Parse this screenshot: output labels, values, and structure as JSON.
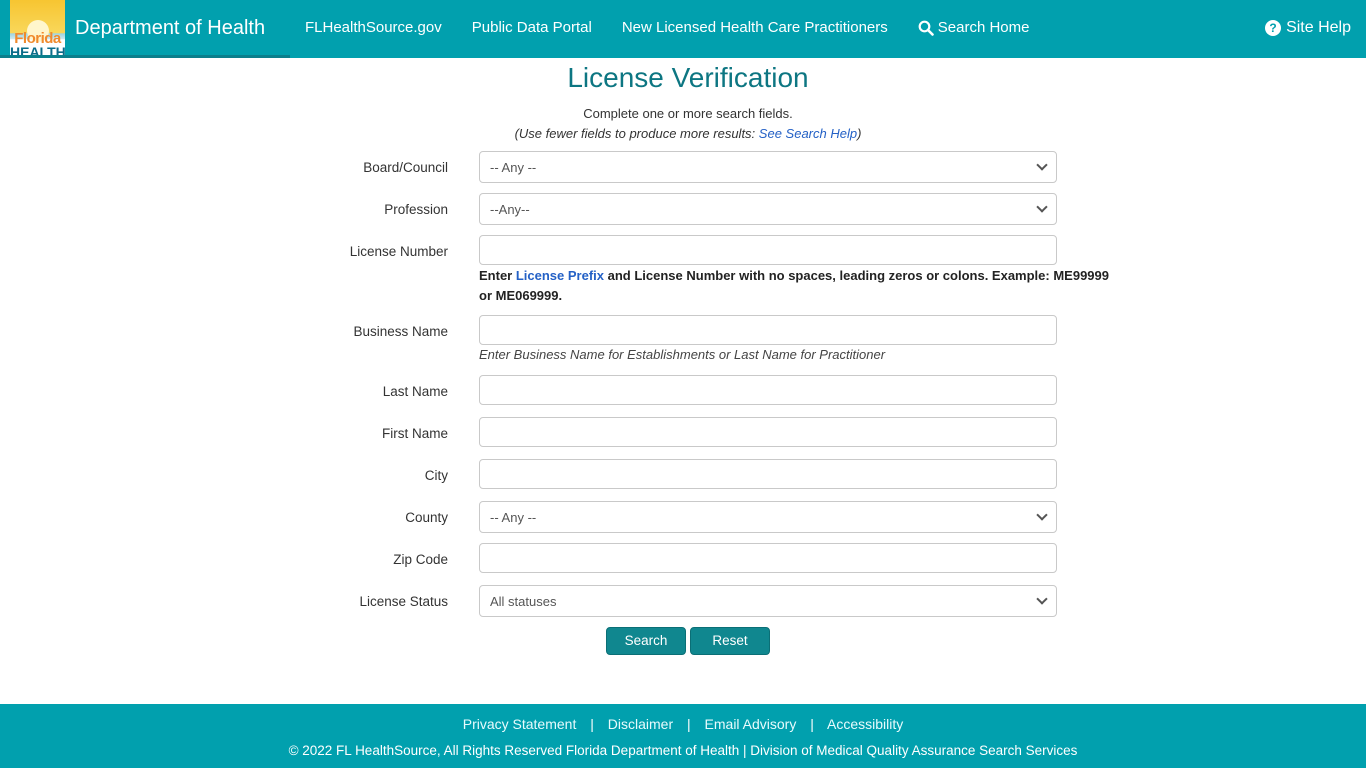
{
  "header": {
    "logo_top": "Florida",
    "logo_bottom": "HEALTH",
    "brand": "Department of Health",
    "nav": [
      {
        "label": "FLHealthSource.gov"
      },
      {
        "label": "Public Data Portal"
      },
      {
        "label": "New Licensed Health Care Practitioners"
      },
      {
        "label": "Search Home",
        "icon": "search-icon"
      }
    ],
    "site_help": "Site Help",
    "site_help_icon": "question-circle-icon"
  },
  "page": {
    "title": "License Verification",
    "subtitle": "Complete one or more search fields.",
    "hint_prefix": "(Use fewer fields to produce more results: ",
    "hint_link": "See Search Help",
    "hint_suffix": ")"
  },
  "form": {
    "board": {
      "label": "Board/Council",
      "value": "-- Any --"
    },
    "profession": {
      "label": "Profession",
      "value": "--Any--"
    },
    "license_number": {
      "label": "License Number",
      "value": "",
      "help_pre": "Enter ",
      "help_link": "License Prefix",
      "help_post": " and License Number with no spaces, leading zeros or colons. Example: ME99999 or ME069999."
    },
    "business_name": {
      "label": "Business Name",
      "value": "",
      "help": "Enter Business Name for Establishments or Last Name for Practitioner"
    },
    "last_name": {
      "label": "Last Name",
      "value": ""
    },
    "first_name": {
      "label": "First Name",
      "value": ""
    },
    "city": {
      "label": "City",
      "value": ""
    },
    "county": {
      "label": "County",
      "value": "-- Any --"
    },
    "zip": {
      "label": "Zip Code",
      "value": ""
    },
    "status": {
      "label": "License Status",
      "value": "All statuses"
    },
    "search_label": "Search",
    "reset_label": "Reset"
  },
  "footer": {
    "links": [
      "Privacy Statement",
      "Disclaimer",
      "Email Advisory",
      "Accessibility"
    ],
    "separator": "|",
    "copyright": "© 2022 FL HealthSource, All Rights Reserved Florida Department of Health | Division of Medical Quality Assurance Search Services"
  },
  "colors": {
    "brand": "#01a0ae",
    "button": "#10878f",
    "title": "#0d7682",
    "link": "#2461c6"
  }
}
